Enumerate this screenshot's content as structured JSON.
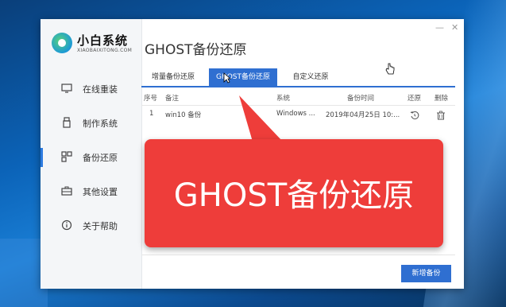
{
  "app": {
    "logo_title": "小白系统",
    "logo_subtitle": "XIAOBAIXITONG.COM"
  },
  "sidebar": {
    "items": [
      {
        "label": "在线重装",
        "icon": "monitor-icon"
      },
      {
        "label": "制作系统",
        "icon": "usb-icon"
      },
      {
        "label": "备份还原",
        "icon": "backup-icon"
      },
      {
        "label": "其他设置",
        "icon": "toolbox-icon"
      },
      {
        "label": "关于帮助",
        "icon": "info-icon"
      }
    ],
    "active_index": 2
  },
  "header": {
    "title": "GHOST备份还原",
    "minimize": "—",
    "close": "✕"
  },
  "tabs": [
    {
      "label": "增量备份还原"
    },
    {
      "label": "GHOST备份还原"
    },
    {
      "label": "自定义还原"
    }
  ],
  "table": {
    "headers": [
      "序号",
      "备注",
      "系统",
      "备份时间",
      "还原",
      "删除"
    ],
    "rows": [
      {
        "index": "1",
        "note": "win10 备份",
        "system": "Windows ...",
        "time": "2019年04月25日 10:..."
      }
    ]
  },
  "buttons": {
    "add_backup": "新增备份"
  },
  "callout": {
    "text": "GHOST备份还原"
  },
  "colors": {
    "accent": "#2f6fd1",
    "callout": "#ee3d3a"
  }
}
